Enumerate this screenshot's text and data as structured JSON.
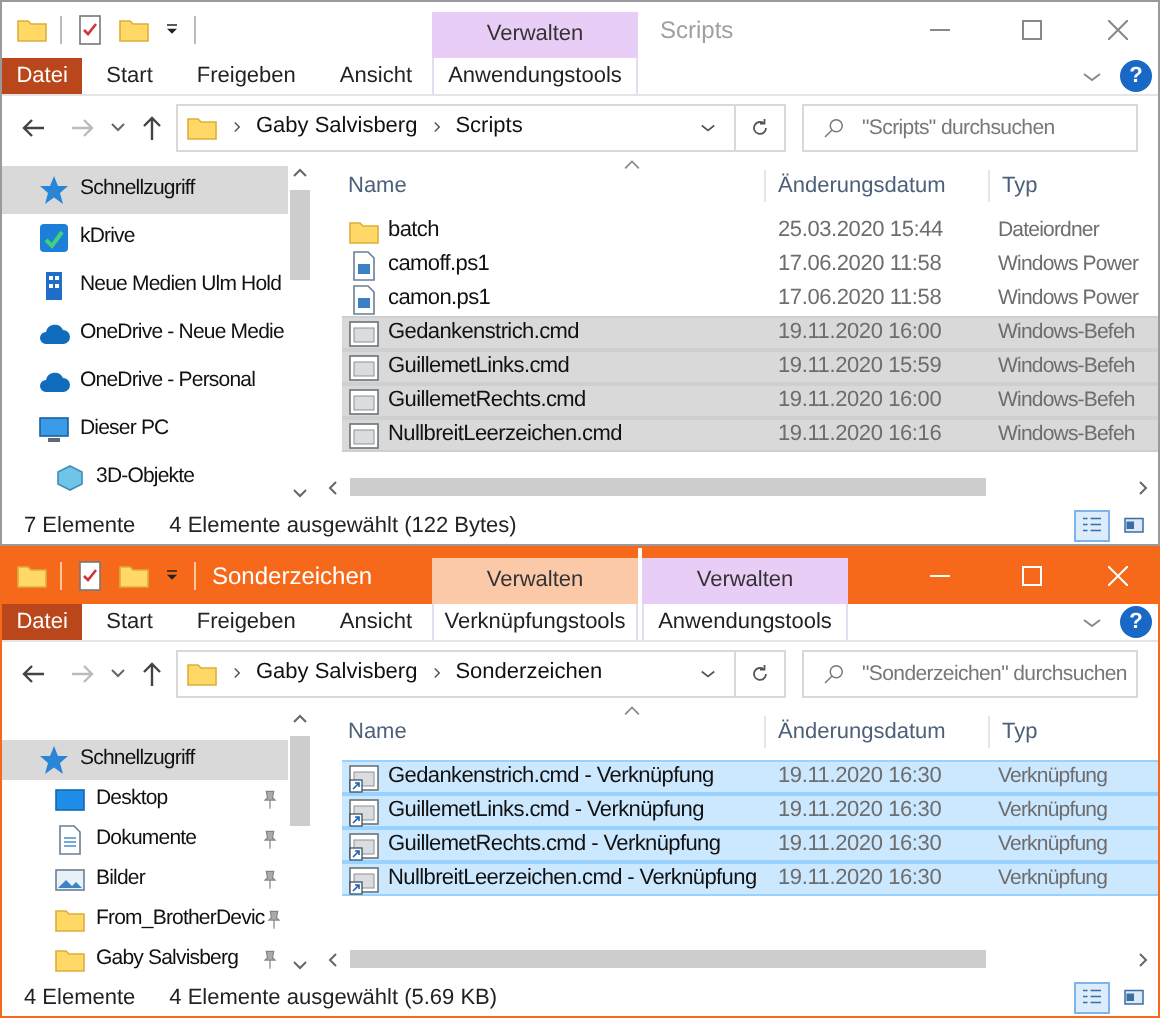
{
  "windows": [
    {
      "active": false,
      "title": "Scripts",
      "ribbon_tabs": [
        {
          "label": "Datei",
          "kind": "file"
        },
        {
          "label": "Start",
          "kind": "tab"
        },
        {
          "label": "Freigeben",
          "kind": "tab"
        },
        {
          "label": "Ansicht",
          "kind": "tab"
        }
      ],
      "context_tabs": [
        {
          "group": "Verwalten",
          "tab": "Anwendungstools",
          "color": "#e8cdf6"
        }
      ],
      "help": "?",
      "address": [
        "Gaby Salvisberg",
        "Scripts"
      ],
      "search": {
        "placeholder": "\"Scripts\" durchsuchen"
      },
      "sidebar": [
        {
          "label": "Schnellzugriff",
          "kind": "star",
          "selected": true
        },
        {
          "label": "kDrive",
          "kind": "kdrive",
          "selected": false
        },
        {
          "label": "Neue Medien Ulm Hold",
          "kind": "building",
          "selected": false
        },
        {
          "label": "OneDrive - Neue Medie",
          "kind": "cloud",
          "selected": false
        },
        {
          "label": "OneDrive - Personal",
          "kind": "cloud",
          "selected": false
        },
        {
          "label": "Dieser PC",
          "kind": "pc",
          "selected": false,
          "children": [
            {
              "label": "3D-Objekte",
              "kind": "cube",
              "selected": false
            }
          ]
        }
      ],
      "columns": [
        "Name",
        "Änderungsdatum",
        "Typ"
      ],
      "files": [
        {
          "name": "batch",
          "date": "25.03.2020 15:44",
          "type": "Dateiordner",
          "kind": "folder",
          "selected": false
        },
        {
          "name": "camoff.ps1",
          "date": "17.06.2020 11:58",
          "type": "Windows Power",
          "kind": "script",
          "selected": false
        },
        {
          "name": "camon.ps1",
          "date": "17.06.2020 11:58",
          "type": "Windows Power",
          "kind": "script",
          "selected": false
        },
        {
          "name": "Gedankenstrich.cmd",
          "date": "19.11.2020 16:00",
          "type": "Windows-Befeh",
          "kind": "cmd",
          "selected": true
        },
        {
          "name": "GuillemetLinks.cmd",
          "date": "19.11.2020 15:59",
          "type": "Windows-Befeh",
          "kind": "cmd",
          "selected": true
        },
        {
          "name": "GuillemetRechts.cmd",
          "date": "19.11.2020 16:00",
          "type": "Windows-Befeh",
          "kind": "cmd",
          "selected": true
        },
        {
          "name": "NullbreitLeerzeichen.cmd",
          "date": "19.11.2020 16:16",
          "type": "Windows-Befeh",
          "kind": "cmd",
          "selected": true
        }
      ],
      "status": {
        "count": "7 Elemente",
        "selection": "4 Elemente ausgewählt (122 Bytes)"
      }
    },
    {
      "active": true,
      "title": "Sonderzeichen",
      "ribbon_tabs": [
        {
          "label": "Datei",
          "kind": "file"
        },
        {
          "label": "Start",
          "kind": "tab"
        },
        {
          "label": "Freigeben",
          "kind": "tab"
        },
        {
          "label": "Ansicht",
          "kind": "tab"
        }
      ],
      "context_tabs": [
        {
          "group": "Verwalten",
          "tab": "Verknüpfungstools",
          "color": "#fbc8a8"
        },
        {
          "group": "Verwalten",
          "tab": "Anwendungstools",
          "color": "#e8cdf6"
        }
      ],
      "help": "?",
      "address": [
        "Gaby Salvisberg",
        "Sonderzeichen"
      ],
      "search": {
        "placeholder": "\"Sonderzeichen\" durchsuchen"
      },
      "sidebar": [
        {
          "label": "Schnellzugriff",
          "kind": "star",
          "selected": true,
          "children": [
            {
              "label": "Desktop",
              "kind": "desktop",
              "selected": false,
              "pinned": true
            },
            {
              "label": "Dokumente",
              "kind": "document",
              "selected": false,
              "pinned": true
            },
            {
              "label": "Bilder",
              "kind": "pictures",
              "selected": false,
              "pinned": true
            },
            {
              "label": "From_BrotherDevic",
              "kind": "folder",
              "selected": false,
              "pinned": true
            },
            {
              "label": "Gaby Salvisberg",
              "kind": "folder",
              "selected": false,
              "pinned": true
            }
          ]
        }
      ],
      "columns": [
        "Name",
        "Änderungsdatum",
        "Typ"
      ],
      "files": [
        {
          "name": "Gedankenstrich.cmd - Verknüpfung",
          "date": "19.11.2020 16:30",
          "type": "Verknüpfung",
          "kind": "shortcut",
          "selected": true
        },
        {
          "name": "GuillemetLinks.cmd - Verknüpfung",
          "date": "19.11.2020 16:30",
          "type": "Verknüpfung",
          "kind": "shortcut",
          "selected": true
        },
        {
          "name": "GuillemetRechts.cmd - Verknüpfung",
          "date": "19.11.2020 16:30",
          "type": "Verknüpfung",
          "kind": "shortcut",
          "selected": true
        },
        {
          "name": "NullbreitLeerzeichen.cmd - Verknüpfung",
          "date": "19.11.2020 16:30",
          "type": "Verknüpfung",
          "kind": "shortcut",
          "selected": true
        }
      ],
      "status": {
        "count": "4 Elemente",
        "selection": "4 Elemente ausgewählt (5.69 KB)"
      }
    }
  ]
}
